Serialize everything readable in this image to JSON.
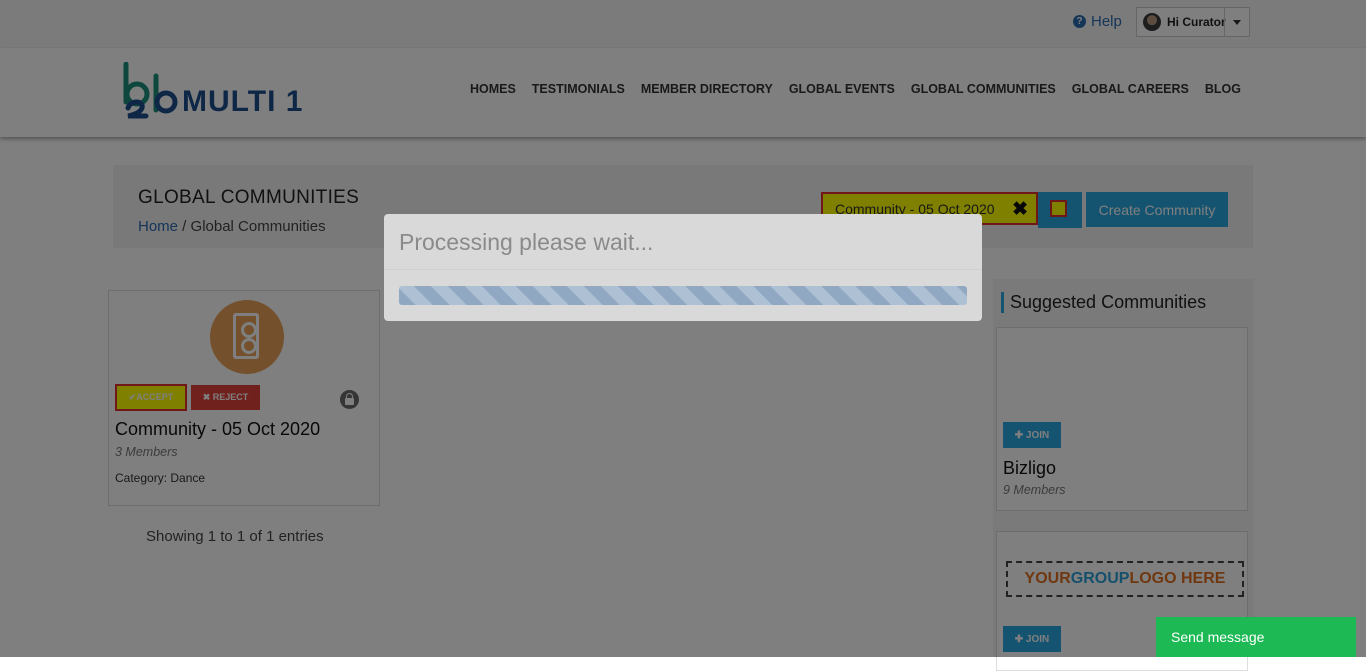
{
  "topbar": {
    "help_label": "Help",
    "user_label": "Hi Curator"
  },
  "brand": {
    "name": "MULTI 1",
    "mark": "b2b"
  },
  "nav": {
    "items": [
      "HOMES",
      "TESTIMONIALS",
      "MEMBER DIRECTORY",
      "GLOBAL EVENTS",
      "GLOBAL COMMUNITIES",
      "GLOBAL CAREERS",
      "BLOG"
    ]
  },
  "page": {
    "title": "GLOBAL COMMUNITIES",
    "breadcrumb_home": "Home",
    "breadcrumb_sep": " / ",
    "breadcrumb_current": "Global Communities"
  },
  "search": {
    "value": "Community - 05 Oct 2020",
    "clear_icon": "✖"
  },
  "create_label": "Create Community",
  "community": {
    "accept_label": "✔ACCEPT",
    "reject_label": "✖ REJECT",
    "name": "Community - 05 Oct 2020",
    "members": "3 Members",
    "category": "Category: Dance"
  },
  "showing": "Showing 1 to 1 of 1 entries",
  "suggested": {
    "title": "Suggested Communities",
    "join_label": "✚ JOIN",
    "items": [
      {
        "name": "Bizligo",
        "members": "9 Members"
      },
      {
        "logo_word1": "YOUR ",
        "logo_word2": "GROUP ",
        "logo_word3": "LOGO HERE"
      }
    ]
  },
  "modal": {
    "title": "Processing please wait..."
  },
  "send_message": "Send message",
  "colors": {
    "accent": "#29a8e0",
    "brand": "#1d4f8c",
    "reject": "#e0433b",
    "send": "#1db954"
  }
}
